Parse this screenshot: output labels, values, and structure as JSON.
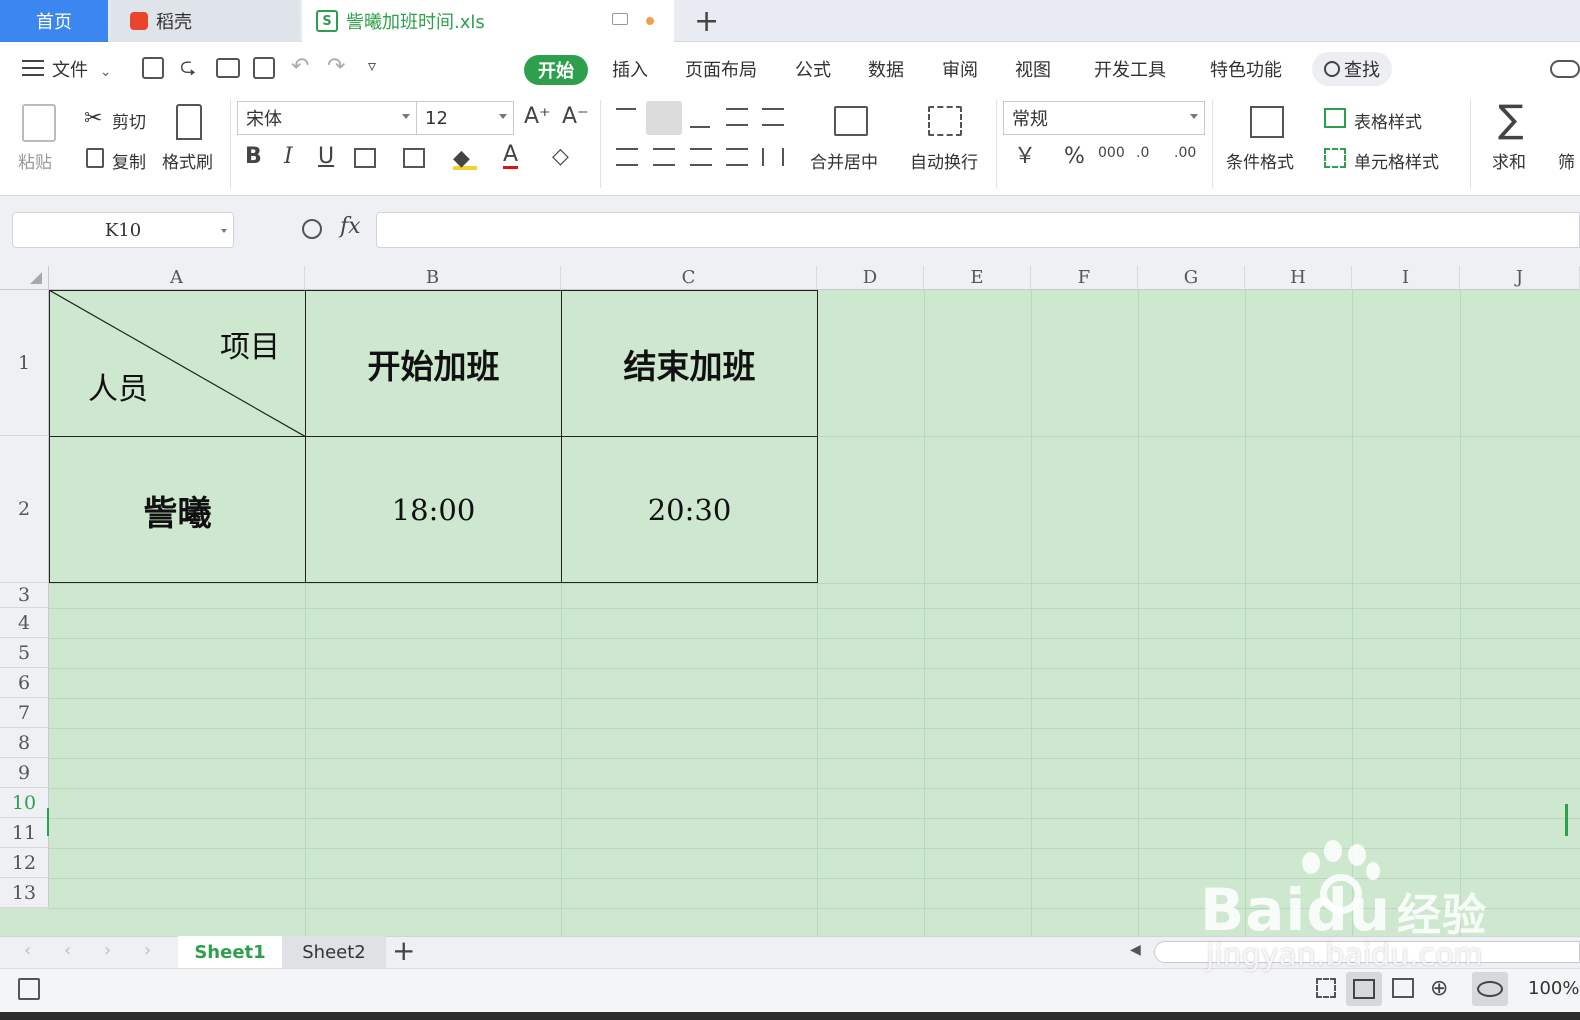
{
  "tabs": {
    "home": "首页",
    "daoke": "稻壳",
    "file": "訾曦加班时间.xls"
  },
  "menu": {
    "file": "文件",
    "items": [
      "开始",
      "插入",
      "页面布局",
      "公式",
      "数据",
      "审阅",
      "视图",
      "开发工具",
      "特色功能"
    ],
    "search": "查找"
  },
  "ribbon": {
    "paste": "粘贴",
    "cut": "剪切",
    "copy": "复制",
    "format_painter": "格式刷",
    "font_name": "宋体",
    "font_size": "12",
    "merge_center": "合并居中",
    "wrap_text": "自动换行",
    "number_format": "常规",
    "conditional_format": "条件格式",
    "table_style": "表格样式",
    "cell_style": "单元格样式",
    "sum": "求和",
    "filter": "筛"
  },
  "formula_bar": {
    "name_box": "K10",
    "fx": "fx",
    "formula": ""
  },
  "columns": [
    "A",
    "B",
    "C",
    "D",
    "E",
    "F",
    "G",
    "H",
    "I",
    "J"
  ],
  "rows": [
    "1",
    "2",
    "3",
    "4",
    "5",
    "6",
    "7",
    "8",
    "9",
    "10",
    "11",
    "12",
    "13"
  ],
  "selected_row": "10",
  "table": {
    "header_diag_top": "项目",
    "header_diag_bottom": "人员",
    "header_b": "开始加班",
    "header_c": "结束加班",
    "name": "訾曦",
    "start": "18:00",
    "end": "20:30"
  },
  "sheets": [
    "Sheet1",
    "Sheet2"
  ],
  "active_sheet": "Sheet1",
  "status": {
    "zoom": "100%"
  },
  "watermark": {
    "brand": "Baidu",
    "brand_cn": "经验",
    "url": "jingyan.baidu.com"
  },
  "colors": {
    "accent": "#2ea04d",
    "home_tab": "#3b86f0",
    "cell_fill": "#cde8cf"
  }
}
